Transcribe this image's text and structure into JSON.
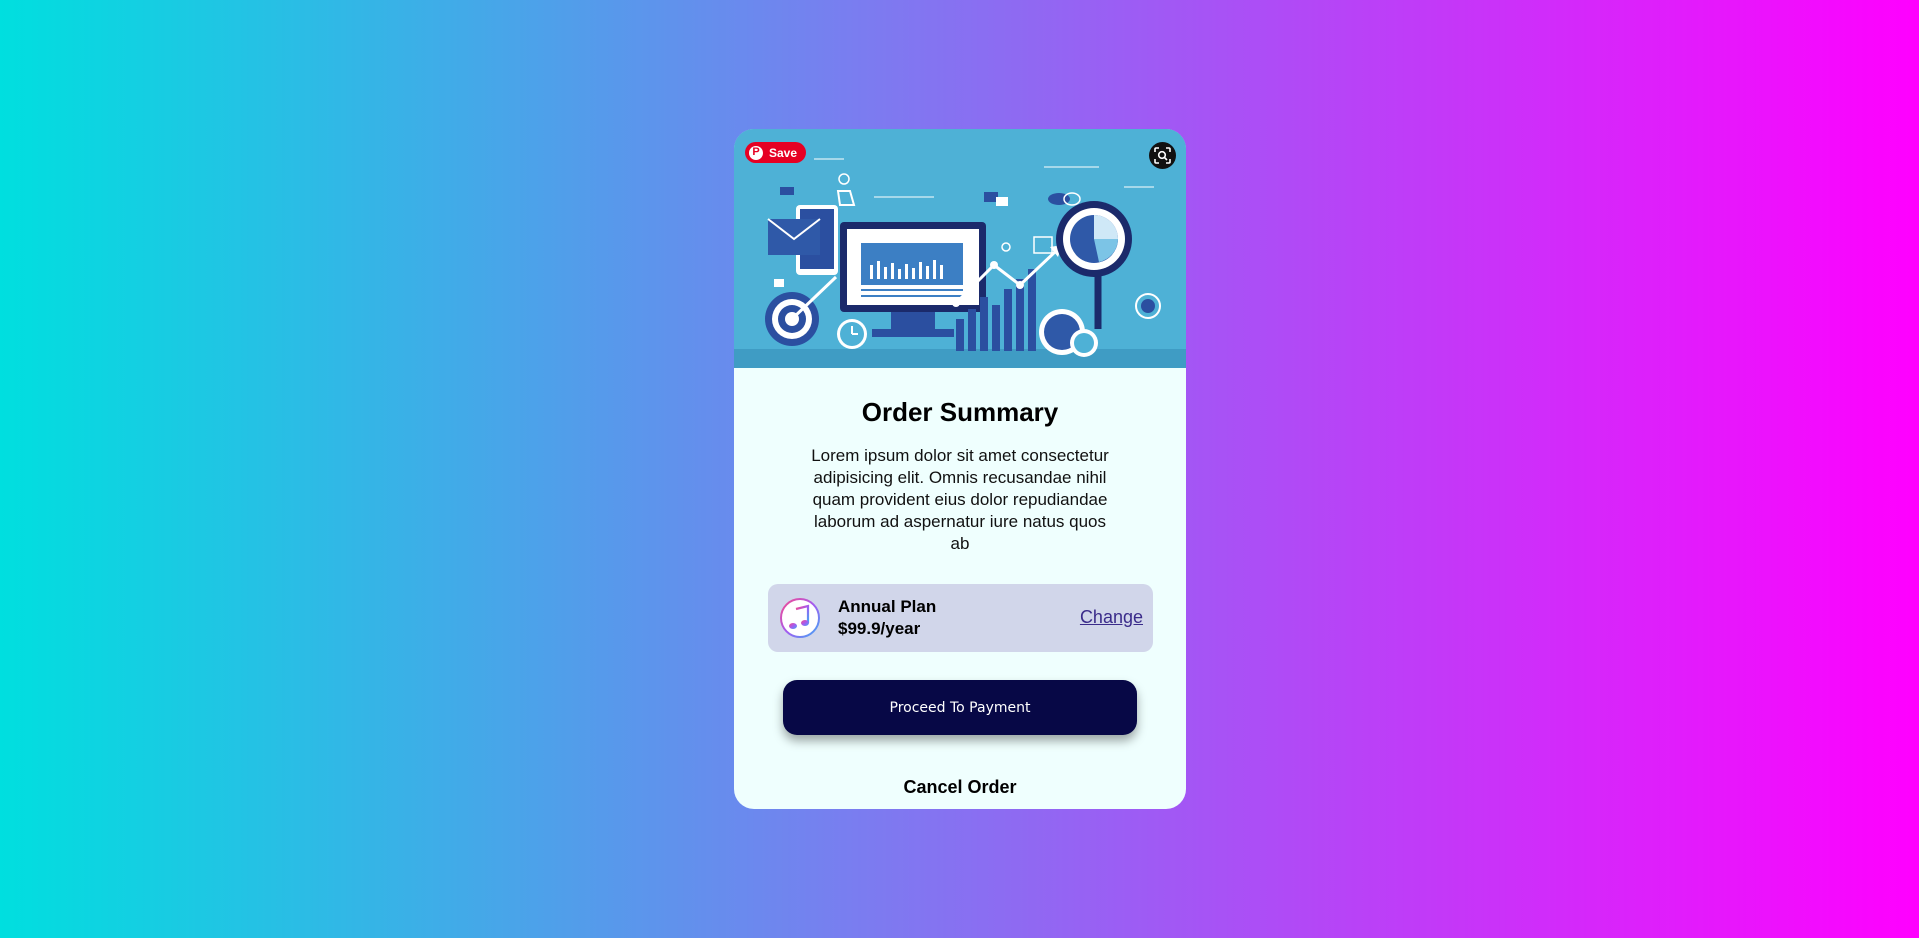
{
  "card": {
    "title": "Order Summary",
    "description": "Lorem ipsum dolor sit amet consectetur adipisicing elit. Omnis recusandae nihil quam provident eius dolor repudiandae laborum ad aspernatur iure natus quos ab"
  },
  "hero_overlay": {
    "save_label": "Save",
    "save_icon": "pinterest-icon",
    "lens_icon": "visual-search-icon"
  },
  "plan": {
    "icon": "music-note-icon",
    "name": "Annual Plan",
    "price": "$99.9/year",
    "change_label": "Change"
  },
  "actions": {
    "proceed_label": "Proceed To Payment",
    "cancel_label": "Cancel Order"
  },
  "colors": {
    "background_start": "#00dfdf",
    "background_end": "#ff00ff",
    "card_background": "#effffe",
    "hero_background": "#4eb1d6",
    "plan_background": "#d1d6ea",
    "proceed_button": "#070846",
    "save_button": "#e60023",
    "link": "#3a2b8a"
  }
}
